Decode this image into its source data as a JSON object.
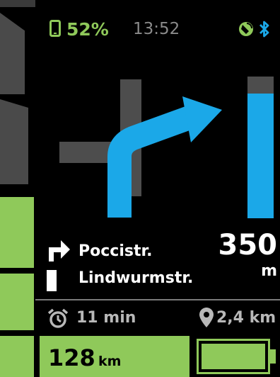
{
  "status": {
    "battery_percent": "52%",
    "time": "13:52",
    "phone_icon": "phone-icon",
    "gps_icon": "satellite-icon",
    "bluetooth_icon": "bluetooth-icon",
    "accent_color": "#8fc95a",
    "blue_color": "#1ba8e8"
  },
  "assist_level_bar": {
    "segments_total": 7,
    "segments_active": 3
  },
  "navigation": {
    "distance_value": "350",
    "distance_unit": "m",
    "next_street": "Poccistr.",
    "current_street": "Lindwurmstr.",
    "distance_progress": 0.88,
    "turn_direction": "right"
  },
  "trip": {
    "eta_label": "11 min",
    "remaining_distance": "2,4 km"
  },
  "footer": {
    "range_value": "128",
    "range_unit": "km",
    "battery_level": 1.0
  }
}
